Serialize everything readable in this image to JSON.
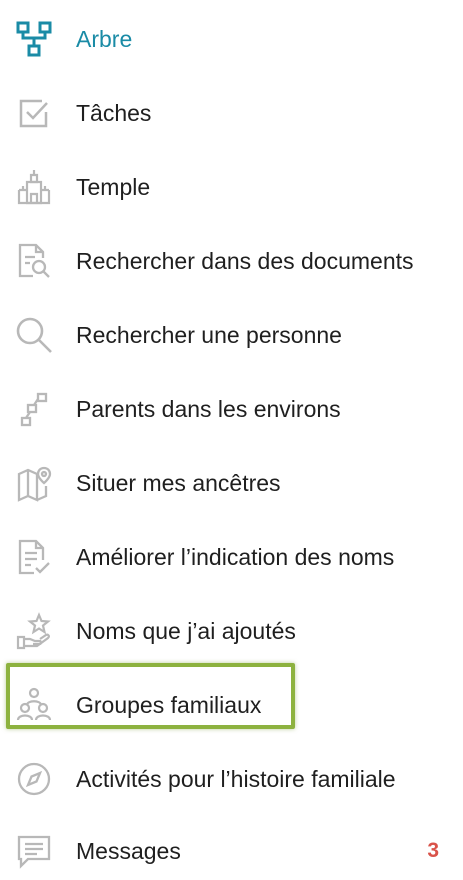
{
  "menu": {
    "items": [
      {
        "label": "Arbre",
        "icon": "tree-icon",
        "active": true
      },
      {
        "label": "Tâches",
        "icon": "tasks-checkbox-icon"
      },
      {
        "label": "Temple",
        "icon": "temple-icon"
      },
      {
        "label": "Rechercher dans des documents",
        "icon": "document-search-icon"
      },
      {
        "label": "Rechercher une personne",
        "icon": "magnifier-icon"
      },
      {
        "label": "Parents dans les environs",
        "icon": "relatives-nearby-icon"
      },
      {
        "label": "Situer mes ancêtres",
        "icon": "map-pin-icon"
      },
      {
        "label": "Améliorer l’indication des noms",
        "icon": "document-check-icon"
      },
      {
        "label": "Noms que j’ai ajoutés",
        "icon": "hand-star-icon"
      },
      {
        "label": "Groupes familiaux",
        "icon": "family-group-icon",
        "highlighted": true
      },
      {
        "label": "Activités pour l’histoire familiale",
        "icon": "compass-icon"
      },
      {
        "label": "Messages",
        "icon": "message-bubble-icon",
        "badge": "3"
      }
    ]
  },
  "colors": {
    "active": "#1a8ba6",
    "icon_gray": "#b8b8b8",
    "badge": "#d9534a",
    "highlight_border": "#8db23f"
  }
}
